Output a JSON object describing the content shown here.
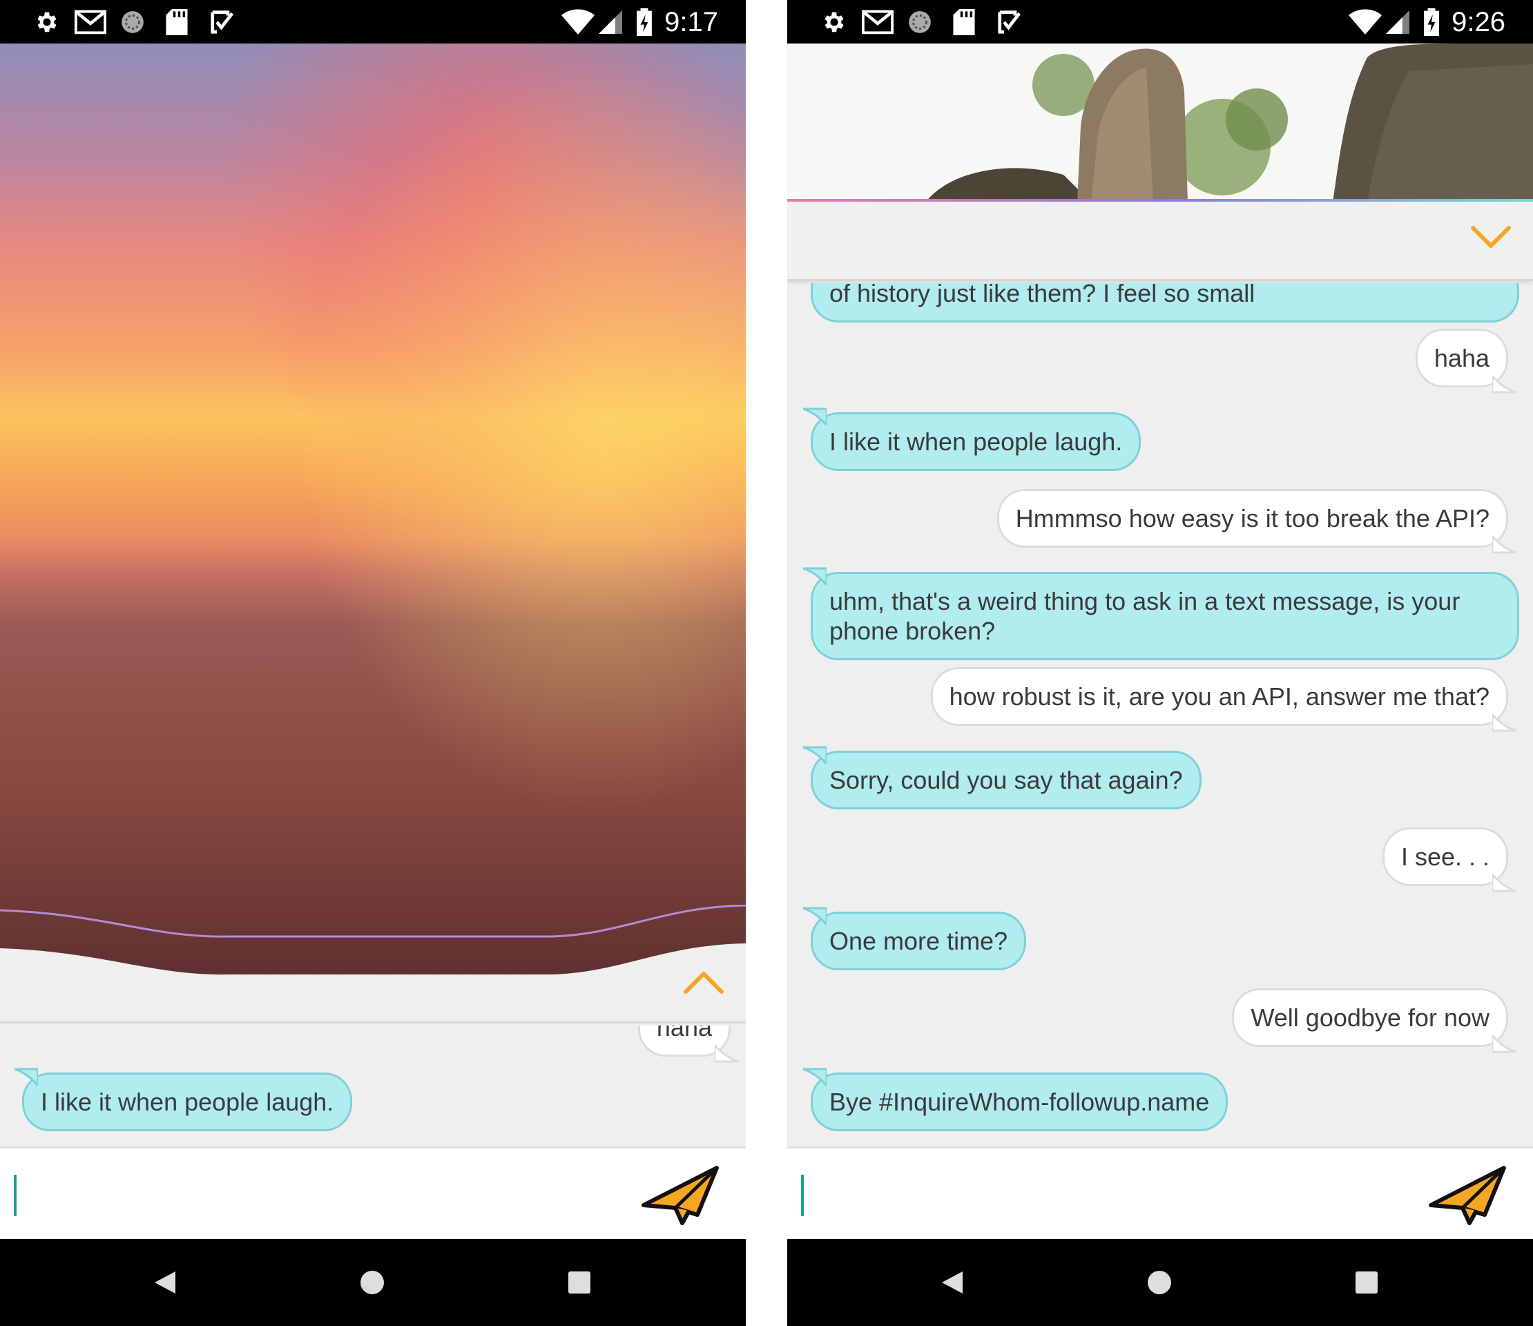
{
  "screens": [
    {
      "status": {
        "time": "9:17"
      },
      "header": {
        "image": "sunset-over-ocean",
        "toggle_icon": "chevron-up-icon"
      },
      "messages": [
        {
          "from": "user",
          "text": "haha"
        },
        {
          "from": "bot",
          "text": "I like it when people laugh."
        }
      ],
      "input": {
        "value": "",
        "send_icon": "paper-plane-icon"
      }
    },
    {
      "status": {
        "time": "9:26"
      },
      "header": {
        "image": "rock-formation-with-trees",
        "toggle_icon": "chevron-down-icon"
      },
      "messages": [
        {
          "from": "bot",
          "text": "of history just like them? I feel so small"
        },
        {
          "from": "user",
          "text": "haha"
        },
        {
          "from": "bot",
          "text": "I like it when people laugh."
        },
        {
          "from": "user",
          "text": "Hmmmso how easy is it too break the API?"
        },
        {
          "from": "bot",
          "text": "uhm, that's a weird thing to ask in a text message, is your",
          "text2": "phone broken?"
        },
        {
          "from": "user",
          "text": "how robust is it, are you an API, answer me that?"
        },
        {
          "from": "bot",
          "text": "Sorry, could you say that again?"
        },
        {
          "from": "user",
          "text": "I see. . ."
        },
        {
          "from": "bot",
          "text": "One more time?"
        },
        {
          "from": "user",
          "text": "Well goodbye for now"
        },
        {
          "from": "bot",
          "text": "Bye #InquireWhom-followup.name"
        }
      ],
      "input": {
        "value": "",
        "send_icon": "paper-plane-icon"
      }
    }
  ],
  "colors": {
    "accent": "#f5a623",
    "bot_bubble": "#b1ecef",
    "user_bubble": "#ffffff",
    "caret": "#1f9d8d"
  },
  "status_icons": [
    "gear-icon",
    "gmail-icon",
    "sync-icon",
    "sd-card-icon",
    "checkbox-icon",
    "wifi-icon",
    "signal-icon",
    "battery-icon"
  ]
}
